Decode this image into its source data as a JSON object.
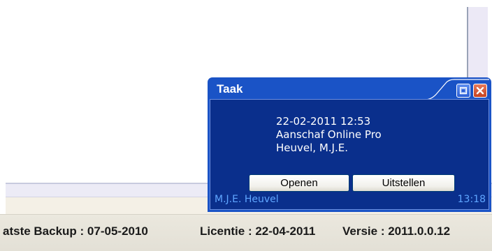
{
  "popup": {
    "title": "Taak",
    "datetime": "22-02-2011 12:53",
    "application": "Aanschaf Online Pro",
    "person": "Heuvel, M.J.E.",
    "open_label": "Openen",
    "postpone_label": "Uitstellen",
    "footer_name": "M.J.E. Heuvel",
    "footer_time": "13:18",
    "icons": {
      "restore": "restore-icon",
      "close": "close-icon"
    }
  },
  "statusbar": {
    "backup": "atste Backup : 07-05-2010",
    "licentie": "Licentie : 22-04-2011",
    "versie": "Versie : 2011.0.0.12"
  },
  "colors": {
    "popup_frame": "#1a53c6",
    "popup_body": "#0a2f8c",
    "footer_text": "#5fa6ff",
    "close_button": "#c7421f"
  }
}
